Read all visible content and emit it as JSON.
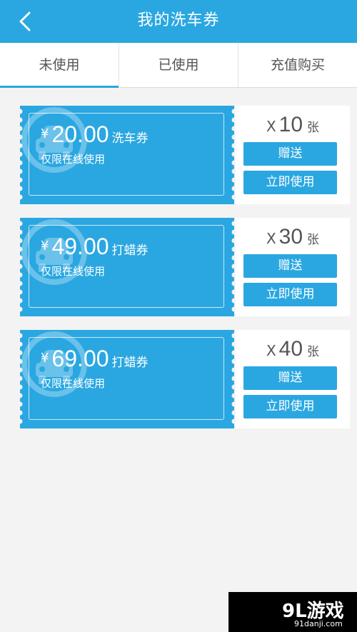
{
  "header": {
    "title": "我的洗车券",
    "back_icon": "chevron-left-icon"
  },
  "tabs": [
    {
      "label": "未使用",
      "active": true
    },
    {
      "label": "已使用",
      "active": false
    },
    {
      "label": "充值购买",
      "active": false
    }
  ],
  "coupons": [
    {
      "currency": "¥",
      "amount": "20.00",
      "kind": "洗车券",
      "note": "仅限在线使用",
      "qty_prefix": "X",
      "qty": "10",
      "qty_unit": "张",
      "gift_label": "赠送",
      "use_label": "立即使用"
    },
    {
      "currency": "¥",
      "amount": "49.00",
      "kind": "打蜡券",
      "note": "仅限在线使用",
      "qty_prefix": "X",
      "qty": "30",
      "qty_unit": "张",
      "gift_label": "赠送",
      "use_label": "立即使用"
    },
    {
      "currency": "¥",
      "amount": "69.00",
      "kind": "打蜡券",
      "note": "仅限在线使用",
      "qty_prefix": "X",
      "qty": "40",
      "qty_unit": "张",
      "gift_label": "赠送",
      "use_label": "立即使用"
    }
  ],
  "watermark": {
    "logo": "9L游戏",
    "url": "91danji.com"
  },
  "colors": {
    "accent": "#2aa7e1",
    "background": "#f3f3f3",
    "card_text": "#ffffff"
  }
}
